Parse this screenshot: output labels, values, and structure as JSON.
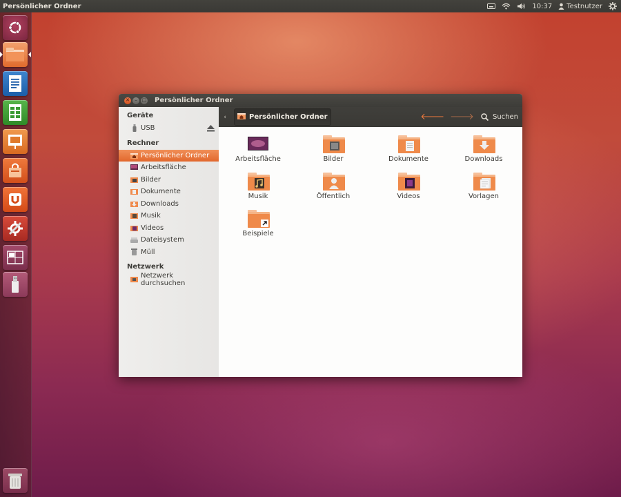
{
  "top_panel": {
    "title": "Persönlicher Ordner",
    "time": "10:37",
    "user": "Testnutzer",
    "icons": [
      "keyboard-icon",
      "wifi-icon",
      "volume-icon",
      "user-icon",
      "gear-icon"
    ]
  },
  "launcher": {
    "items": [
      "dash-home",
      "files",
      "writer",
      "calc",
      "impress",
      "software-center",
      "ubuntu-one",
      "system-settings",
      "workspace-switcher",
      "usb-drive",
      "trash"
    ]
  },
  "window": {
    "title": "Persönlicher Ordner",
    "breadcrumb": "Persönlicher Ordner",
    "search_label": "Suchen"
  },
  "sidebar": {
    "sections": [
      {
        "header": "Geräte",
        "items": [
          {
            "label": "USB",
            "icon": "usb-icon"
          }
        ]
      },
      {
        "header": "Rechner",
        "items": [
          {
            "label": "Persönlicher Ordner",
            "icon": "home-folder-icon",
            "active": true
          },
          {
            "label": "Arbeitsfläche",
            "icon": "desktop-icon"
          },
          {
            "label": "Bilder",
            "icon": "pictures-icon"
          },
          {
            "label": "Dokumente",
            "icon": "documents-icon"
          },
          {
            "label": "Downloads",
            "icon": "downloads-icon"
          },
          {
            "label": "Musik",
            "icon": "music-icon"
          },
          {
            "label": "Videos",
            "icon": "videos-icon"
          },
          {
            "label": "Dateisystem",
            "icon": "filesystem-icon"
          },
          {
            "label": "Müll",
            "icon": "trash-icon"
          }
        ]
      },
      {
        "header": "Netzwerk",
        "items": [
          {
            "label": "Netzwerk durchsuchen",
            "icon": "network-icon"
          }
        ]
      }
    ]
  },
  "folders": [
    {
      "label": "Arbeitsfläche",
      "icon": "desktop-folder-icon"
    },
    {
      "label": "Bilder",
      "icon": "pictures-folder-icon"
    },
    {
      "label": "Dokumente",
      "icon": "documents-folder-icon"
    },
    {
      "label": "Downloads",
      "icon": "downloads-folder-icon"
    },
    {
      "label": "Musik",
      "icon": "music-folder-icon"
    },
    {
      "label": "Öffentlich",
      "icon": "public-folder-icon"
    },
    {
      "label": "Videos",
      "icon": "videos-folder-icon"
    },
    {
      "label": "Vorlagen",
      "icon": "templates-folder-icon"
    },
    {
      "label": "Beispiele",
      "icon": "examples-link-icon"
    }
  ],
  "colors": {
    "accent": "#e2672c",
    "panel": "#3c3b37",
    "folder": "#f0874c"
  }
}
